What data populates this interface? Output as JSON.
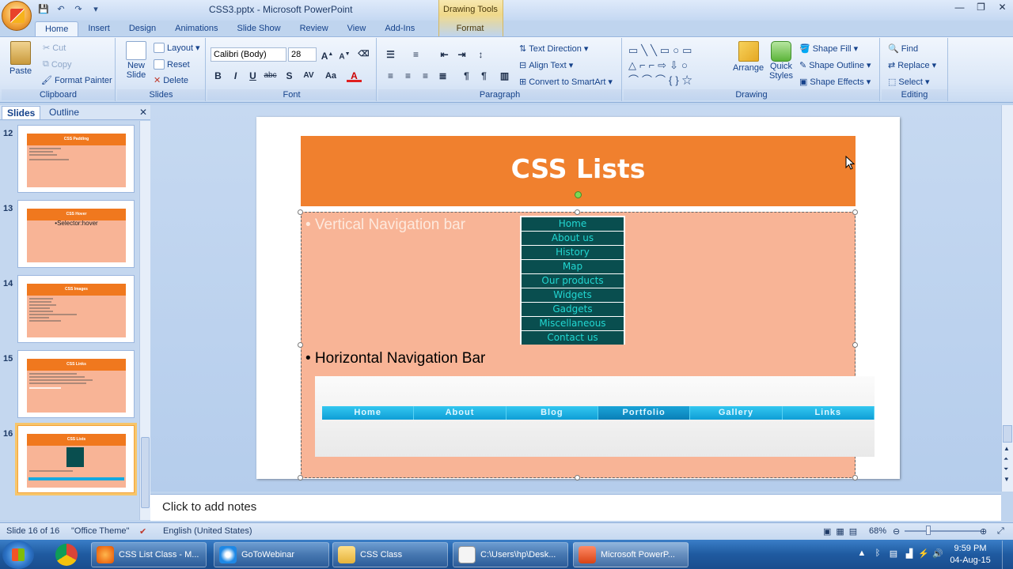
{
  "window": {
    "title": "CSS3.pptx - Microsoft PowerPoint",
    "contextual_group": "Drawing Tools",
    "controls": [
      "—",
      "❐",
      "✕"
    ]
  },
  "ribbon_tabs": [
    "Home",
    "Insert",
    "Design",
    "Animations",
    "Slide Show",
    "Review",
    "View",
    "Add-Ins"
  ],
  "contextual_tab": "Format",
  "clipboard": {
    "paste": "Paste",
    "cut": "Cut",
    "copy": "Copy",
    "format_painter": "Format Painter",
    "label": "Clipboard"
  },
  "slides_group": {
    "new_slide": "New Slide",
    "layout": "Layout",
    "reset": "Reset",
    "delete": "Delete",
    "label": "Slides"
  },
  "font": {
    "family": "Calibri (Body)",
    "size": "28",
    "label": "Font",
    "buttons": [
      "B",
      "I",
      "U",
      "abc",
      "S",
      "AV",
      "Aa",
      "A"
    ]
  },
  "paragraph": {
    "text_direction": "Text Direction",
    "align_text": "Align Text",
    "convert": "Convert to SmartArt",
    "label": "Paragraph"
  },
  "drawing": {
    "arrange": "Arrange",
    "quick_styles": "Quick Styles",
    "shape_fill": "Shape Fill",
    "shape_outline": "Shape Outline",
    "shape_effects": "Shape Effects",
    "label": "Drawing"
  },
  "editing": {
    "find": "Find",
    "replace": "Replace",
    "select": "Select",
    "label": "Editing"
  },
  "pane": {
    "tabs": [
      "Slides",
      "Outline"
    ],
    "thumbnails": [
      {
        "num": "12",
        "title": "CSS Padding"
      },
      {
        "num": "13",
        "title": "CSS Hover",
        "text": "•Selector:hover"
      },
      {
        "num": "14",
        "title": "CSS Images"
      },
      {
        "num": "15",
        "title": "CSS Links"
      },
      {
        "num": "16",
        "title": "CSS Lists"
      }
    ]
  },
  "slide": {
    "title": "CSS Lists",
    "bullet1": "• Vertical Navigation bar",
    "bullet2": "• Horizontal Navigation Bar",
    "vertical_nav": [
      "Home",
      "About us",
      "History",
      "Map",
      "Our products",
      "Widgets",
      "Gadgets",
      "Miscellaneous",
      "Contact us"
    ],
    "horizontal_nav": [
      "Home",
      "About",
      "Blog",
      "Portfolio",
      "Gallery",
      "Links"
    ],
    "horizontal_active": 3
  },
  "notes": {
    "placeholder": "Click to add notes"
  },
  "status": {
    "slide": "Slide 16 of 16",
    "theme": "\"Office Theme\"",
    "language": "English (United States)",
    "zoom": "68%"
  },
  "taskbar": {
    "items": [
      "CSS List Class - M...",
      "GoToWebinar",
      "CSS Class",
      "C:\\Users\\hp\\Desk...",
      "Microsoft PowerP..."
    ],
    "time": "9:59 PM",
    "date": "04-Aug-15"
  }
}
